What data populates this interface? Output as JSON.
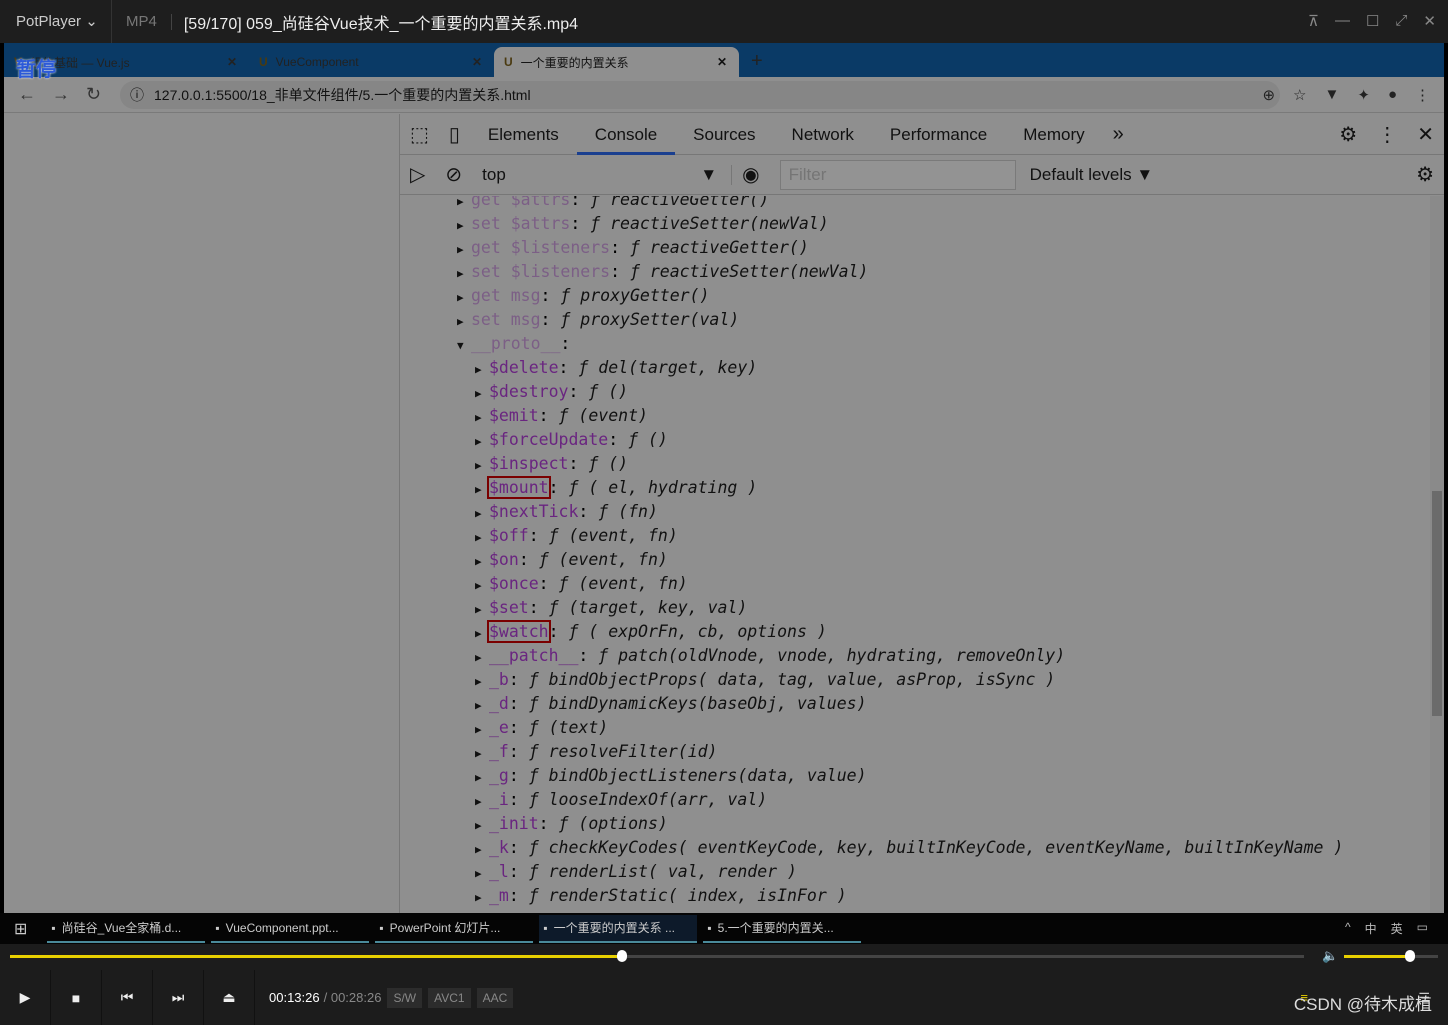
{
  "player": {
    "name": "PotPlayer",
    "format": "MP4",
    "title": "[59/170] 059_尚硅谷Vue技术_一个重要的内置关系.mp4",
    "overlay": "暂停",
    "current_time": "00:13:26",
    "total_time": "00:28:26",
    "badges": [
      "S/W",
      "AVC1",
      "AAC"
    ],
    "progress_percent": 47.3,
    "volume_percent": 70,
    "watermark": "CSDN @待木成植",
    "accent": "#e8d000"
  },
  "browser": {
    "tabs": [
      {
        "label": "组件基础 — Vue.js"
      },
      {
        "label": "VueComponent"
      },
      {
        "label": "一个重要的内置关系",
        "active": true
      }
    ],
    "url": "127.0.0.1:5500/18_非单文件组件/5.一个重要的内置关系.html"
  },
  "devtools": {
    "tabs": [
      "Elements",
      "Console",
      "Sources",
      "Network",
      "Performance",
      "Memory"
    ],
    "active_tab": "Console",
    "context": "top",
    "filter_placeholder": "Filter",
    "levels": "Default levels ▼",
    "rows": [
      {
        "l": 1,
        "k": "get $attrs",
        "s": "ƒ reactiveGetter()",
        "dim": true
      },
      {
        "l": 1,
        "k": "set $attrs",
        "s": "ƒ reactiveSetter(newVal)",
        "dim": true
      },
      {
        "l": 1,
        "k": "get $listeners",
        "s": "ƒ reactiveGetter()",
        "dim": true
      },
      {
        "l": 1,
        "k": "set $listeners",
        "s": "ƒ reactiveSetter(newVal)",
        "dim": true
      },
      {
        "l": 1,
        "k": "get msg",
        "s": "ƒ proxyGetter()",
        "dim": true
      },
      {
        "l": 1,
        "k": "set msg",
        "s": "ƒ proxySetter(val)",
        "dim": true
      },
      {
        "l": 1,
        "k": "__proto__",
        "s": "",
        "dim": true,
        "open": true
      },
      {
        "l": 2,
        "k": "$delete",
        "s": "ƒ del(target, key)"
      },
      {
        "l": 2,
        "k": "$destroy",
        "s": "ƒ ()"
      },
      {
        "l": 2,
        "k": "$emit",
        "s": "ƒ (event)"
      },
      {
        "l": 2,
        "k": "$forceUpdate",
        "s": "ƒ ()"
      },
      {
        "l": 2,
        "k": "$inspect",
        "s": "ƒ ()"
      },
      {
        "l": 2,
        "k": "$mount",
        "s": "ƒ ( el, hydrating )",
        "hl": true
      },
      {
        "l": 2,
        "k": "$nextTick",
        "s": "ƒ (fn)"
      },
      {
        "l": 2,
        "k": "$off",
        "s": "ƒ (event, fn)"
      },
      {
        "l": 2,
        "k": "$on",
        "s": "ƒ (event, fn)"
      },
      {
        "l": 2,
        "k": "$once",
        "s": "ƒ (event, fn)"
      },
      {
        "l": 2,
        "k": "$set",
        "s": "ƒ (target, key, val)"
      },
      {
        "l": 2,
        "k": "$watch",
        "s": "ƒ ( expOrFn, cb, options )",
        "hl": true
      },
      {
        "l": 2,
        "k": "__patch__",
        "s": "ƒ patch(oldVnode, vnode, hydrating, removeOnly)"
      },
      {
        "l": 2,
        "k": "_b",
        "s": "ƒ bindObjectProps( data, tag, value, asProp, isSync )"
      },
      {
        "l": 2,
        "k": "_d",
        "s": "ƒ bindDynamicKeys(baseObj, values)"
      },
      {
        "l": 2,
        "k": "_e",
        "s": "ƒ (text)"
      },
      {
        "l": 2,
        "k": "_f",
        "s": "ƒ resolveFilter(id)"
      },
      {
        "l": 2,
        "k": "_g",
        "s": "ƒ bindObjectListeners(data, value)"
      },
      {
        "l": 2,
        "k": "_i",
        "s": "ƒ looseIndexOf(arr, val)"
      },
      {
        "l": 2,
        "k": "_init",
        "s": "ƒ (options)"
      },
      {
        "l": 2,
        "k": "_k",
        "s": "ƒ checkKeyCodes( eventKeyCode, key, builtInKeyCode, eventKeyName, builtInKeyName )"
      },
      {
        "l": 2,
        "k": "_l",
        "s": "ƒ renderList( val, render )"
      },
      {
        "l": 2,
        "k": "_m",
        "s": "ƒ renderStatic( index, isInFor )"
      }
    ]
  },
  "taskbar": {
    "items": [
      "尚硅谷_Vue全家桶.d...",
      "VueComponent.ppt...",
      "PowerPoint 幻灯片...",
      "一个重要的内置关系 ...",
      "5.一个重要的内置关..."
    ],
    "active": 3,
    "tray": [
      "^",
      "中",
      "英"
    ]
  }
}
